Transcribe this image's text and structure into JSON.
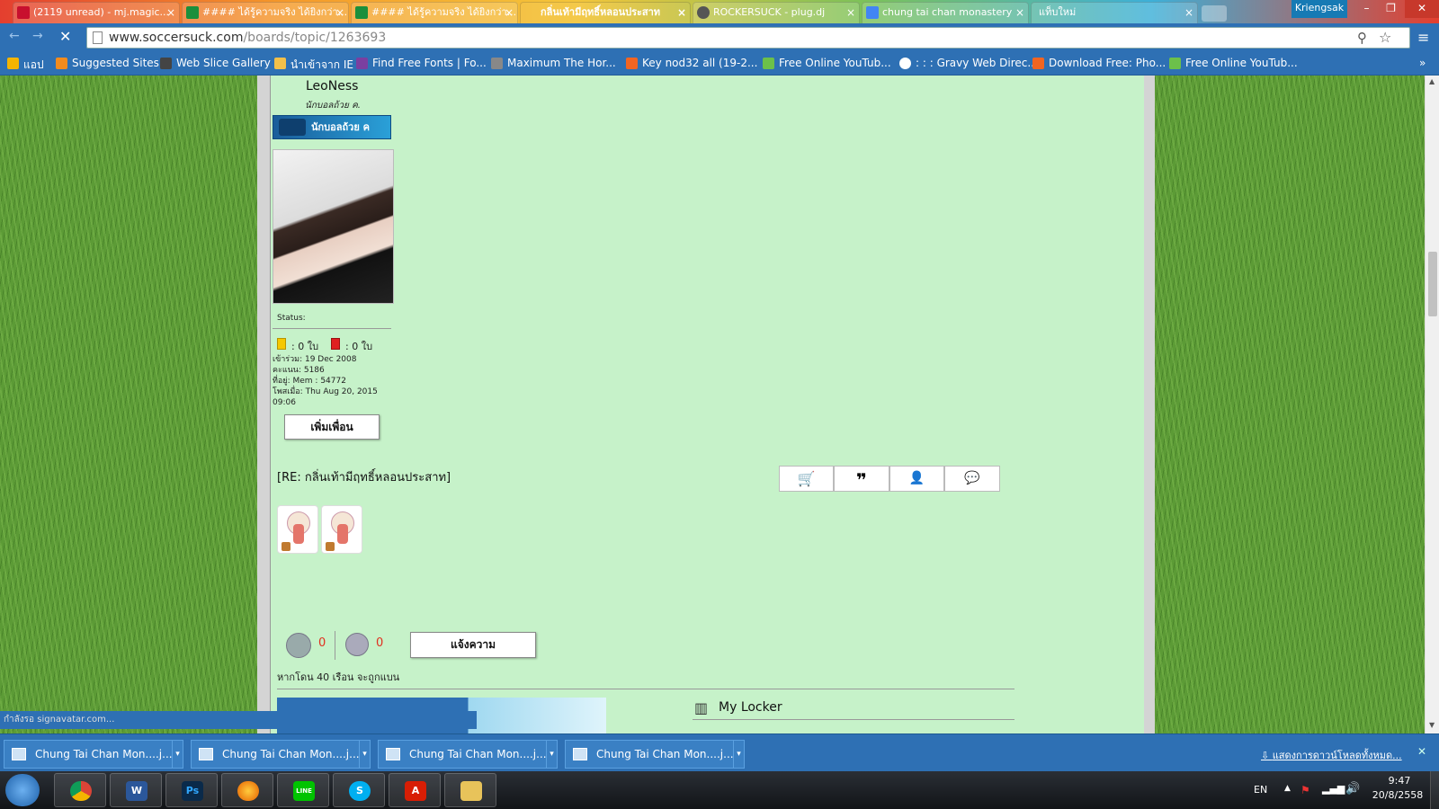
{
  "tabs": [
    {
      "label": "(2119 unread) - mj.magic...",
      "color": "#c8102e"
    },
    {
      "label": "#### ได้รู้ความจริง ได้ยิงกว่า...",
      "color": "#1b8f3c"
    },
    {
      "label": "#### ได้รู้ความจริง ได้ยิงกว่า...",
      "color": "#1b8f3c"
    },
    {
      "label": "กลิ่นเท้ามีฤทธิ์หลอนประสาท",
      "color": "#3db0d8"
    },
    {
      "label": "ROCKERSUCK - plug.dj",
      "color": "#555555"
    },
    {
      "label": "chung tai chan monastery",
      "color": "#4285f4"
    },
    {
      "label": "แท็บใหม่",
      "color": "#eeeeee"
    }
  ],
  "window": {
    "user": "Kriengsak",
    "minimize": "–",
    "restore": "❐",
    "close": "✕"
  },
  "toolbar": {
    "url_host": "www.soccersuck.com",
    "url_path": "/boards/topic/1263693"
  },
  "bookmarks": [
    {
      "label": "แอป",
      "color": "#f4b400"
    },
    {
      "label": "Suggested Sites",
      "color": "#f38b1d"
    },
    {
      "label": "Web Slice Gallery",
      "color": "#444444"
    },
    {
      "label": "นำเข้าจาก IE",
      "color": "#f2c04a"
    },
    {
      "label": "Find Free Fonts | Fo...",
      "color": "#7b3fa0"
    },
    {
      "label": "Maximum The Hor...",
      "color": "#888888"
    },
    {
      "label": "Key nod32 all (19-2...",
      "color": "#f26522"
    },
    {
      "label": "Free Online YouTub...",
      "color": "#6cc04a"
    },
    {
      "label": ": : : Gravy Web Direc...",
      "color": "#ffffff"
    },
    {
      "label": "Download Free: Pho...",
      "color": "#f26522"
    },
    {
      "label": "Free Online YouTub...",
      "color": "#6cc04a"
    }
  ],
  "profile": {
    "name": "LeoNess",
    "rank": "นักบอลถ้วย ค.",
    "rank_badge": "นักบอลถ้วย ค",
    "status_label": "Status:",
    "yellow_cards": ": 0 ใบ",
    "red_cards": ": 0 ใบ",
    "joined": "เข้าร่วม: 19 Dec 2008",
    "score": "คะแนน: 5186",
    "location": "ที่อยู่: Mem : 54772",
    "posted": "โพสเมื่อ: Thu Aug 20, 2015 09:06",
    "add_friend": "เพิ่มเพื่อน"
  },
  "post": {
    "title": "[RE: กลิ่นเท้ามีฤทธิ์หลอนประสาท]",
    "likes": "0",
    "dislikes": "0",
    "report_button": "แจ้งความ",
    "warning": "หากโดน 40 เรือน จะถูกแบน",
    "locker_title": "My Locker"
  },
  "statusbar": {
    "text": "กำลังรอ signavatar.com..."
  },
  "downloads": {
    "items": [
      "Chung Tai Chan Mon....j...",
      "Chung Tai Chan Mon....j...",
      "Chung Tai Chan Mon....j...",
      "Chung Tai Chan Mon....j..."
    ],
    "show_all": "แสดงการดาวน์โหลดทั้งหมด..."
  },
  "taskbar": {
    "apps": [
      "chrome-icon",
      "word-icon",
      "photoshop-icon",
      "firefox-icon",
      "line-icon",
      "skype-icon",
      "acrobat-icon",
      "explorer-icon"
    ],
    "lang": "EN",
    "time": "9:47",
    "date": "20/8/2558"
  }
}
